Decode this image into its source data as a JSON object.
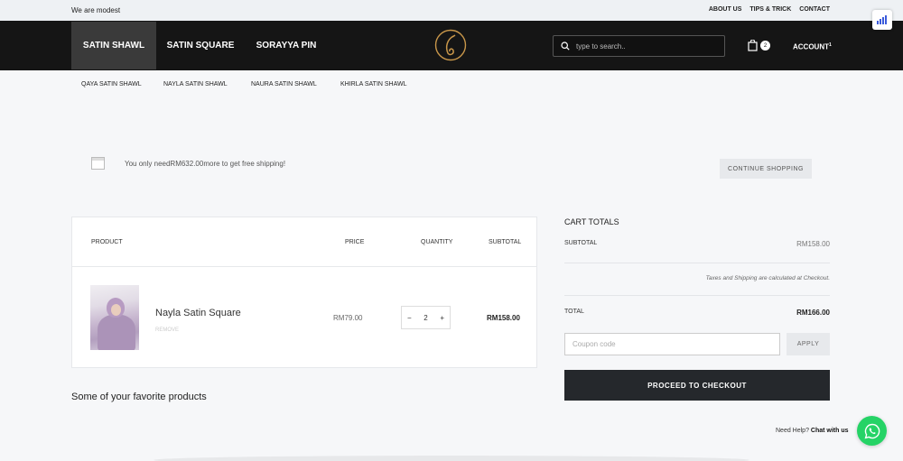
{
  "topbar": {
    "tagline": "We are modest",
    "links": [
      "ABOUT US",
      "TIPS & TRICK",
      "CONTACT"
    ]
  },
  "nav": {
    "items": [
      "SATIN SHAWL",
      "SATIN SQUARE",
      "SORAYYA PIN"
    ],
    "search_placeholder": "type to search..",
    "cart_count": "2",
    "account_label": "ACCOUNT",
    "account_badge": "1"
  },
  "subnav": {
    "items": [
      "QAYA SATIN SHAWL",
      "NAYLA SATIN SHAWL",
      "NAURA SATIN SHAWL",
      "KHIRLA SATIN SHAWL"
    ]
  },
  "shipping": {
    "message": "You only needRM632.00more to get free shipping!",
    "continue_label": "CONTINUE SHOPPING"
  },
  "cart": {
    "headers": {
      "product": "PRODUCT",
      "price": "PRICE",
      "quantity": "QUANTITY",
      "subtotal": "SUBTOTAL"
    },
    "item": {
      "name": "Nayla Satin Square",
      "remove_label": "REMOVE",
      "price": "RM79.00",
      "quantity": "2",
      "subtotal": "RM158.00"
    }
  },
  "favorites_title": "Some of your favorite products",
  "totals": {
    "title": "CART TOTALS",
    "subtotal_label": "SUBTOTAL",
    "subtotal_value": "RM158.00",
    "tax_note": "Taxes and Shipping are calculated at Checkout.",
    "total_label": "TOTAL",
    "total_value": "RM166.00",
    "coupon_placeholder": "Coupon code",
    "apply_label": "APPLY",
    "checkout_label": "PROCEED TO CHECKOUT"
  },
  "help": {
    "prefix": "Need Help?",
    "chat": "Chat with us"
  },
  "colors": {
    "navbar": "#151515",
    "checkout_button": "#25282c",
    "whatsapp": "#25d366",
    "logo_gold": "#c9974a"
  }
}
